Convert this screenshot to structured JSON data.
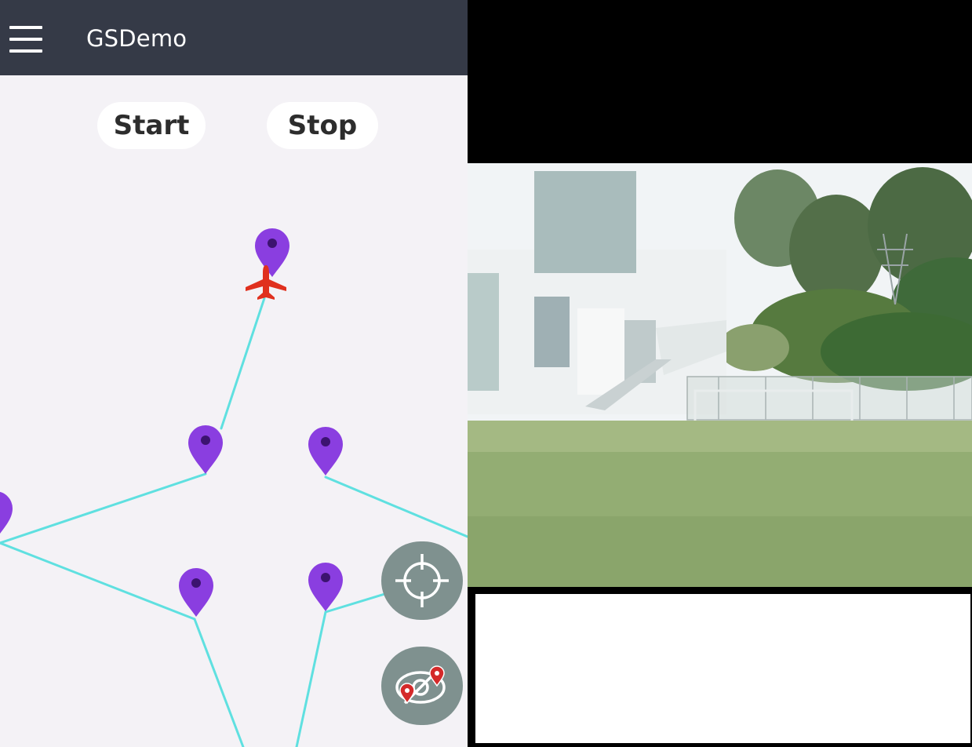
{
  "app": {
    "title": "GSDemo",
    "menu_icon": "hamburger-menu-icon"
  },
  "controls": {
    "start_label": "Start",
    "stop_label": "Stop"
  },
  "map": {
    "waypoint_color": "#8a3ee0",
    "flight_path_color": "#5fe0e0",
    "aircraft_color": "#e0301e",
    "aircraft_icon": "airplane-icon",
    "waypoint_icon": "map-pin-icon"
  },
  "fab": {
    "locate_icon": "crosshair-icon",
    "focus_icon": "focus-map-icon",
    "color": "#7f918f"
  },
  "video": {
    "content": "live-camera-feed"
  },
  "colors": {
    "appbar": "#353a47",
    "map_background": "#f4f2f6"
  }
}
